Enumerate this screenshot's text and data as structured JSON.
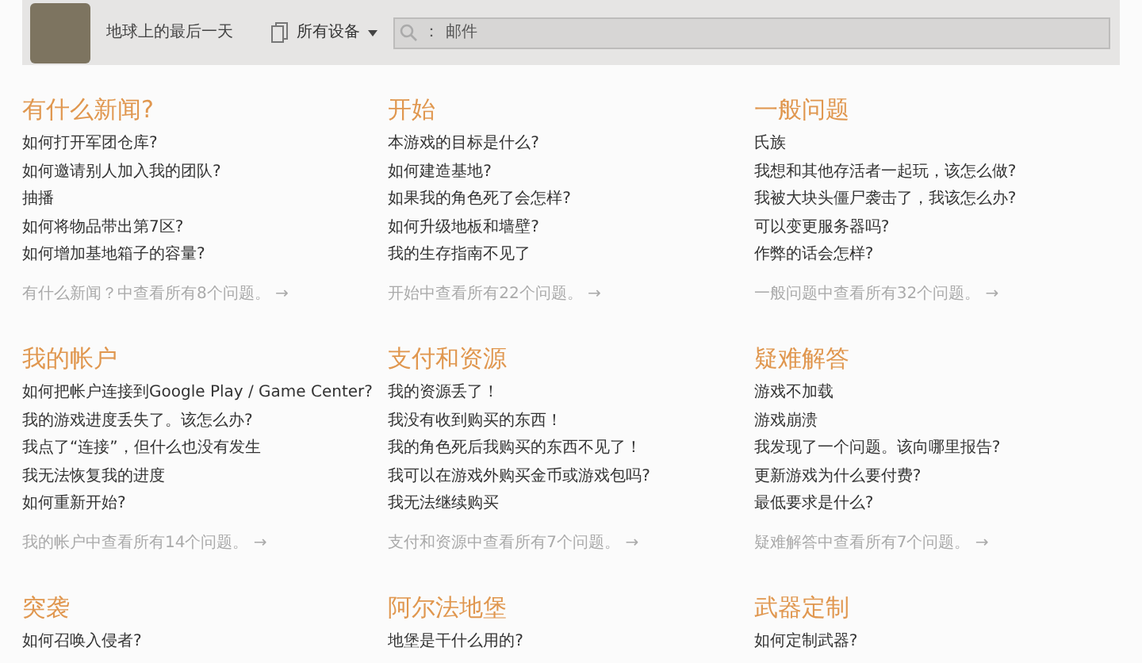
{
  "header": {
    "game_title": "地球上的最后一天",
    "device_filter": "所有设备",
    "search": {
      "prefix": "：",
      "value": "邮件"
    }
  },
  "sections": [
    {
      "title": "有什么新闻?",
      "questions": [
        "如何打开军团仓库?",
        "如何邀请别人加入我的团队?",
        "抽播",
        "如何将物品带出第7区?",
        "如何增加基地箱子的容量?"
      ],
      "footer": "有什么新闻？中查看所有8个问题。 →"
    },
    {
      "title": "开始",
      "questions": [
        "本游戏的目标是什么?",
        "如何建造基地?",
        "如果我的角色死了会怎样?",
        "如何升级地板和墙壁?",
        "我的生存指南不见了"
      ],
      "footer": "开始中查看所有22个问题。 →"
    },
    {
      "title": "一般问题",
      "questions": [
        "氏族",
        "我想和其他存活者一起玩，该怎么做?",
        "我被大块头僵尸袭击了，我该怎么办?",
        "可以变更服务器吗?",
        "作弊的话会怎样?"
      ],
      "footer": "一般问题中查看所有32个问题。 →"
    },
    {
      "title": "我的帐户",
      "questions": [
        "如何把帐户连接到Google Play / Game Center?",
        "我的游戏进度丢失了。该怎么办?",
        "我点了“连接”，但什么也没有发生",
        "我无法恢复我的进度",
        "如何重新开始?"
      ],
      "footer": "我的帐户中查看所有14个问题。 →"
    },
    {
      "title": "支付和资源",
      "questions": [
        "我的资源丢了！",
        "我没有收到购买的东西！",
        "我的角色死后我购买的东西不见了！",
        "我可以在游戏外购买金币或游戏包吗?",
        "我无法继续购买"
      ],
      "footer": "支付和资源中查看所有7个问题。 →"
    },
    {
      "title": "疑难解答",
      "questions": [
        "游戏不加载",
        "游戏崩溃",
        "我发现了一个问题。该向哪里报告?",
        "更新游戏为什么要付费?",
        "最低要求是什么?"
      ],
      "footer": "疑难解答中查看所有7个问题。 →"
    },
    {
      "title": "突袭",
      "questions": [
        "如何召唤入侵者?"
      ]
    },
    {
      "title": "阿尔法地堡",
      "questions": [
        "地堡是干什么用的?"
      ]
    },
    {
      "title": "武器定制",
      "questions": [
        "如何定制武器?"
      ]
    }
  ]
}
